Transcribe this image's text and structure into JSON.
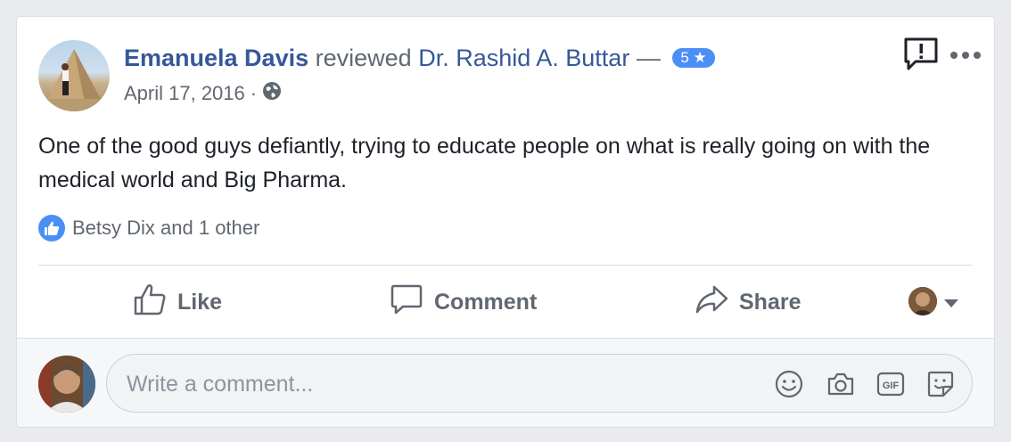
{
  "post": {
    "author": "Emanuela Davis",
    "verb": "reviewed",
    "target": "Dr. Rashid A. Buttar",
    "dash": "—",
    "rating": "5 ★",
    "date": "April 17, 2016",
    "date_separator": "·",
    "privacy_icon": "globe-icon",
    "body": "One of the good guys defiantly, trying to educate people on what is really going on with the medical world and Big Pharma."
  },
  "reactions": {
    "icon": "like-icon",
    "text": "Betsy Dix and 1 other"
  },
  "actions": {
    "like_label": "Like",
    "comment_label": "Comment",
    "share_label": "Share"
  },
  "composer": {
    "placeholder": "Write a comment...",
    "icons": [
      "emoji-icon",
      "camera-icon",
      "gif-icon",
      "sticker-icon"
    ]
  },
  "colors": {
    "link": "#365899",
    "accent": "#4b8ff6",
    "muted": "#616770",
    "background": "#e9ebee"
  }
}
